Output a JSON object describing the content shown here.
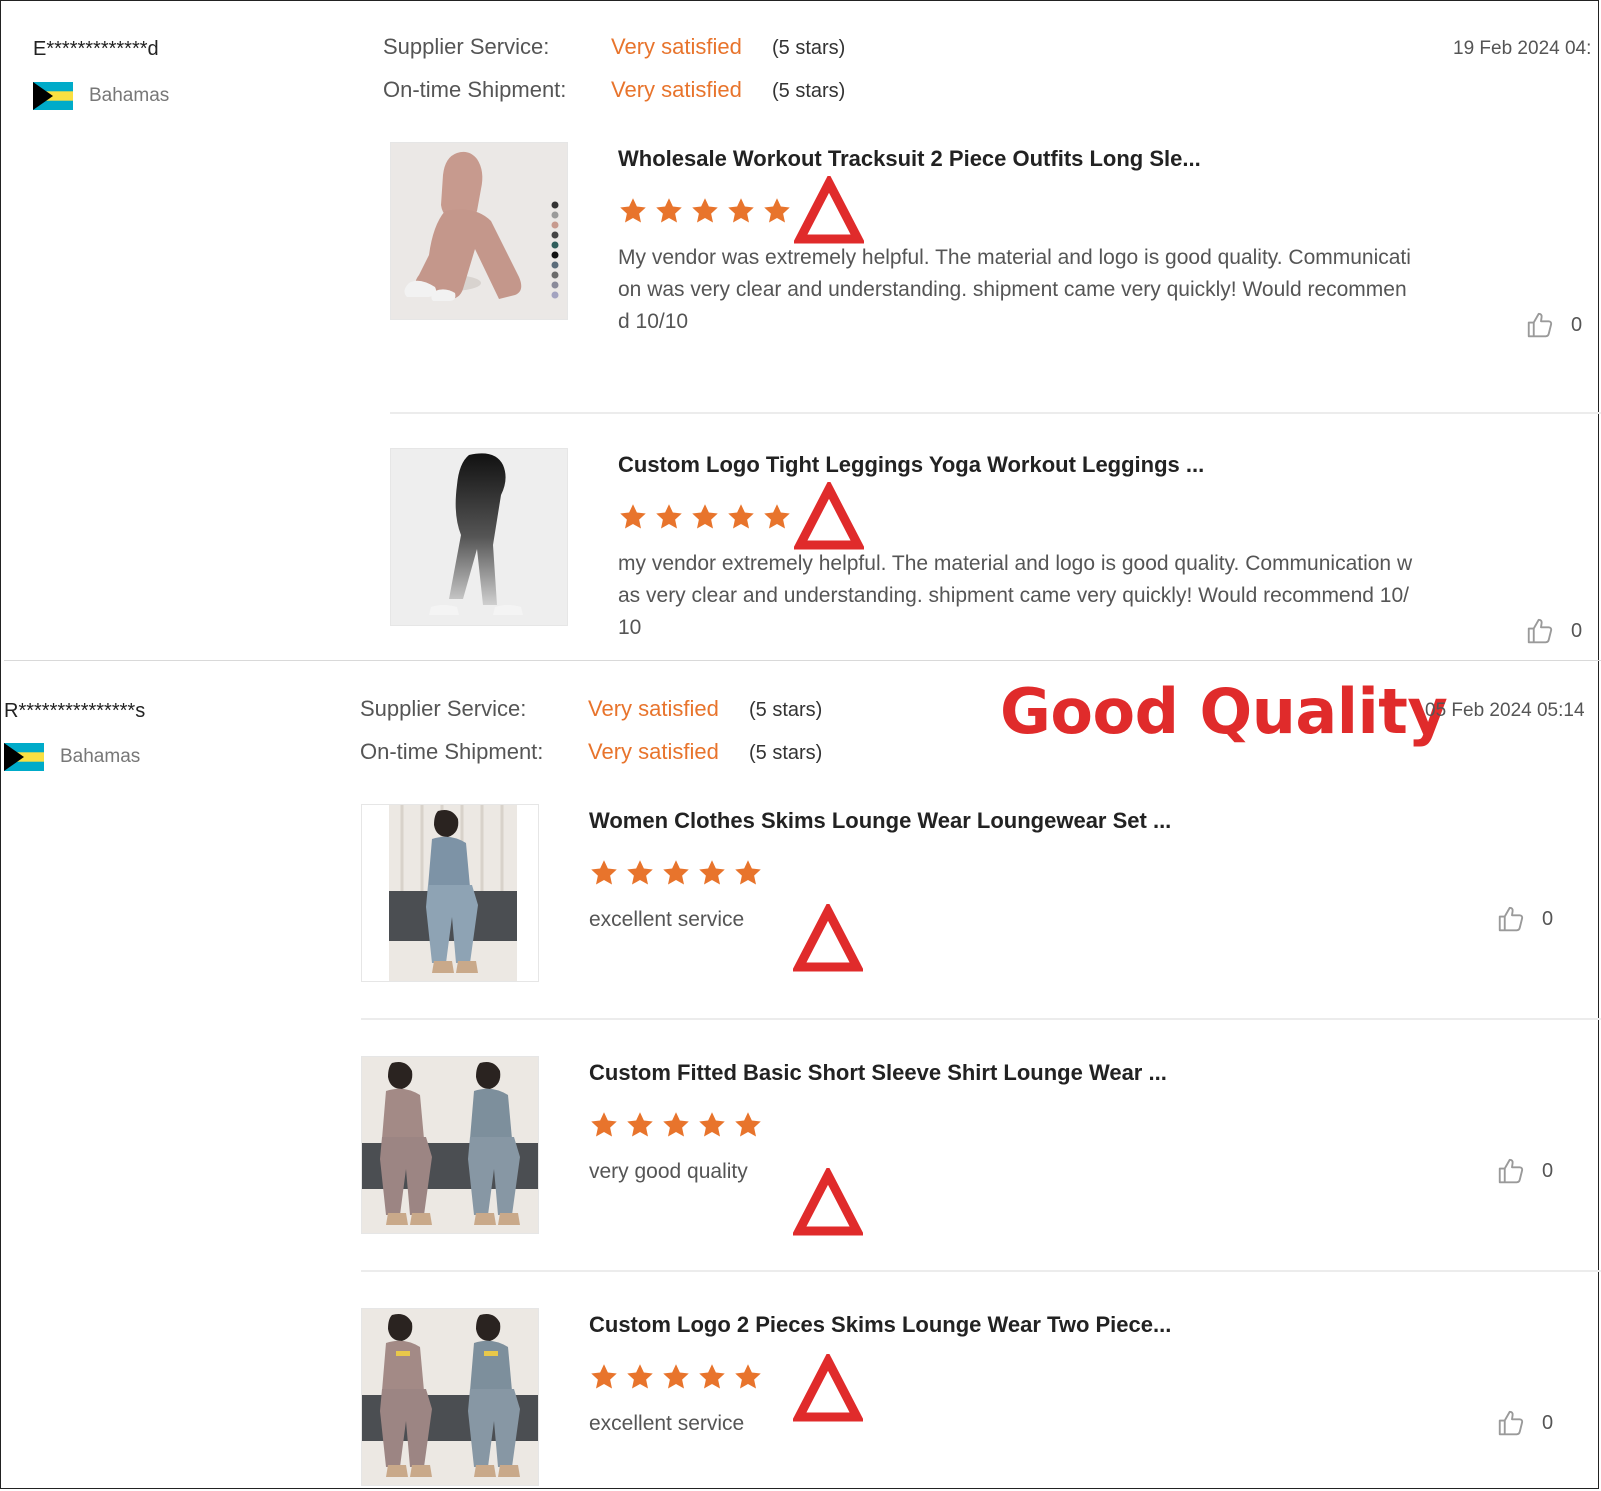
{
  "headline": "Good Quality",
  "colors": {
    "accent": "#e8742c",
    "star": "#e8742c",
    "annotation": "#e02b2b"
  },
  "reviews": [
    {
      "user": "E*************d",
      "country": "Bahamas",
      "date": "19 Feb 2024 04:",
      "ratings": [
        {
          "label": "Supplier Service:",
          "value": "Very satisfied",
          "stars_text": "(5 stars)"
        },
        {
          "label": "On-time Shipment:",
          "value": "Very satisfied",
          "stars_text": "(5 stars)"
        }
      ],
      "items": [
        {
          "title": "Wholesale Workout Tracksuit 2 Piece Outfits Long Sle...",
          "rating": 5,
          "text": "My vendor was extremely helpful. The material and logo is good quality. Communication was very clear and understanding. shipment came very quickly! Would recommend 10/10",
          "likes": "0"
        },
        {
          "title": "Custom Logo Tight Leggings Yoga Workout Leggings ...",
          "rating": 5,
          "text": "my vendor extremely helpful. The material and logo is good quality. Communication was very clear and understanding. shipment came very quickly! Would recommend 10/10",
          "likes": "0"
        }
      ]
    },
    {
      "user": "R***************s",
      "country": "Bahamas",
      "date": "05 Feb 2024 05:14",
      "ratings": [
        {
          "label": "Supplier Service:",
          "value": "Very satisfied",
          "stars_text": "(5 stars)"
        },
        {
          "label": "On-time Shipment:",
          "value": "Very satisfied",
          "stars_text": "(5 stars)"
        }
      ],
      "items": [
        {
          "title": "Women Clothes Skims Lounge Wear Loungewear Set ...",
          "rating": 5,
          "text": "excellent service",
          "likes": "0"
        },
        {
          "title": "Custom Fitted Basic Short Sleeve Shirt Lounge Wear ...",
          "rating": 5,
          "text": "very good quality",
          "likes": "0"
        },
        {
          "title": "Custom Logo 2 Pieces Skims Lounge Wear Two Piece...",
          "rating": 5,
          "text": "excellent service",
          "likes": "0"
        }
      ]
    }
  ]
}
